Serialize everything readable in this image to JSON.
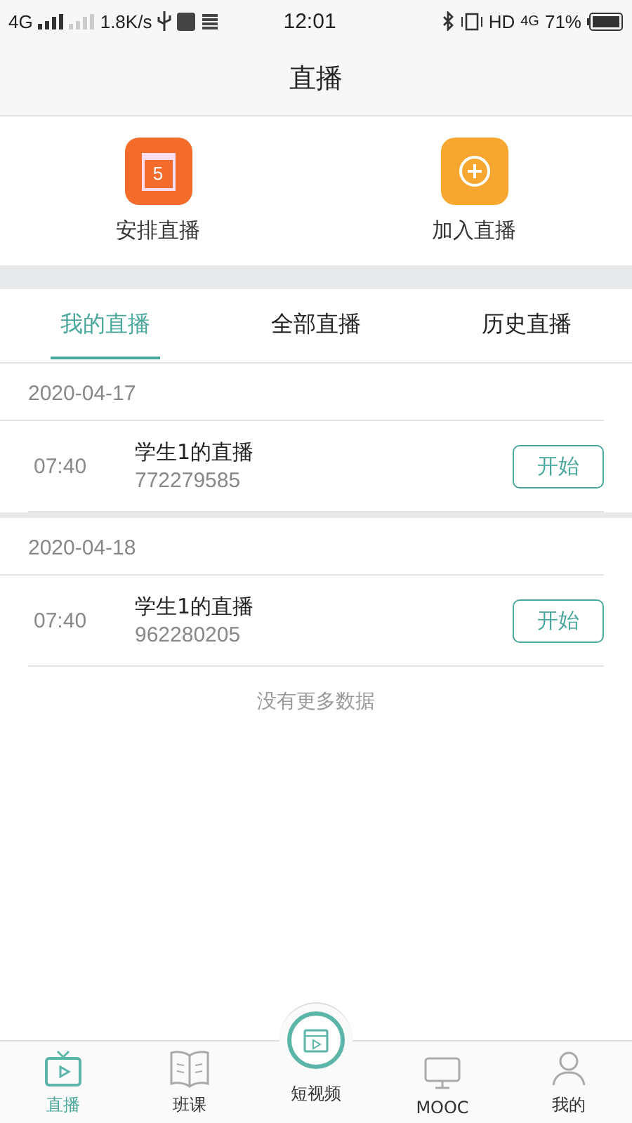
{
  "status_bar": {
    "network": "4G",
    "speed": "1.8K/s",
    "time": "12:01",
    "hd": "HD",
    "network2": "4G",
    "battery": "71%"
  },
  "header": {
    "title": "直播"
  },
  "actions": [
    {
      "kind": "calendar",
      "label": "安排直播",
      "icon_text": "5"
    },
    {
      "kind": "join",
      "label": "加入直播"
    }
  ],
  "tabs": [
    {
      "label": "我的直播",
      "selected": true
    },
    {
      "label": "全部直播",
      "selected": false
    },
    {
      "label": "历史直播",
      "selected": false
    }
  ],
  "groups": [
    {
      "date": "2020-04-17",
      "items": [
        {
          "time": "07:40",
          "title": "学生1的直播",
          "id": "772279585",
          "button": "开始"
        }
      ]
    },
    {
      "date": "2020-04-18",
      "items": [
        {
          "time": "07:40",
          "title": "学生1的直播",
          "id": "962280205",
          "button": "开始"
        }
      ]
    }
  ],
  "footer_note": "没有更多数据",
  "nav": [
    {
      "kind": "tv",
      "label": "直播",
      "selected": true
    },
    {
      "kind": "book",
      "label": "班课",
      "selected": false
    },
    {
      "kind": "video",
      "label": "短视频",
      "selected": false
    },
    {
      "kind": "monitor",
      "label": "MOOC",
      "selected": false
    },
    {
      "kind": "person",
      "label": "我的",
      "selected": false
    }
  ]
}
